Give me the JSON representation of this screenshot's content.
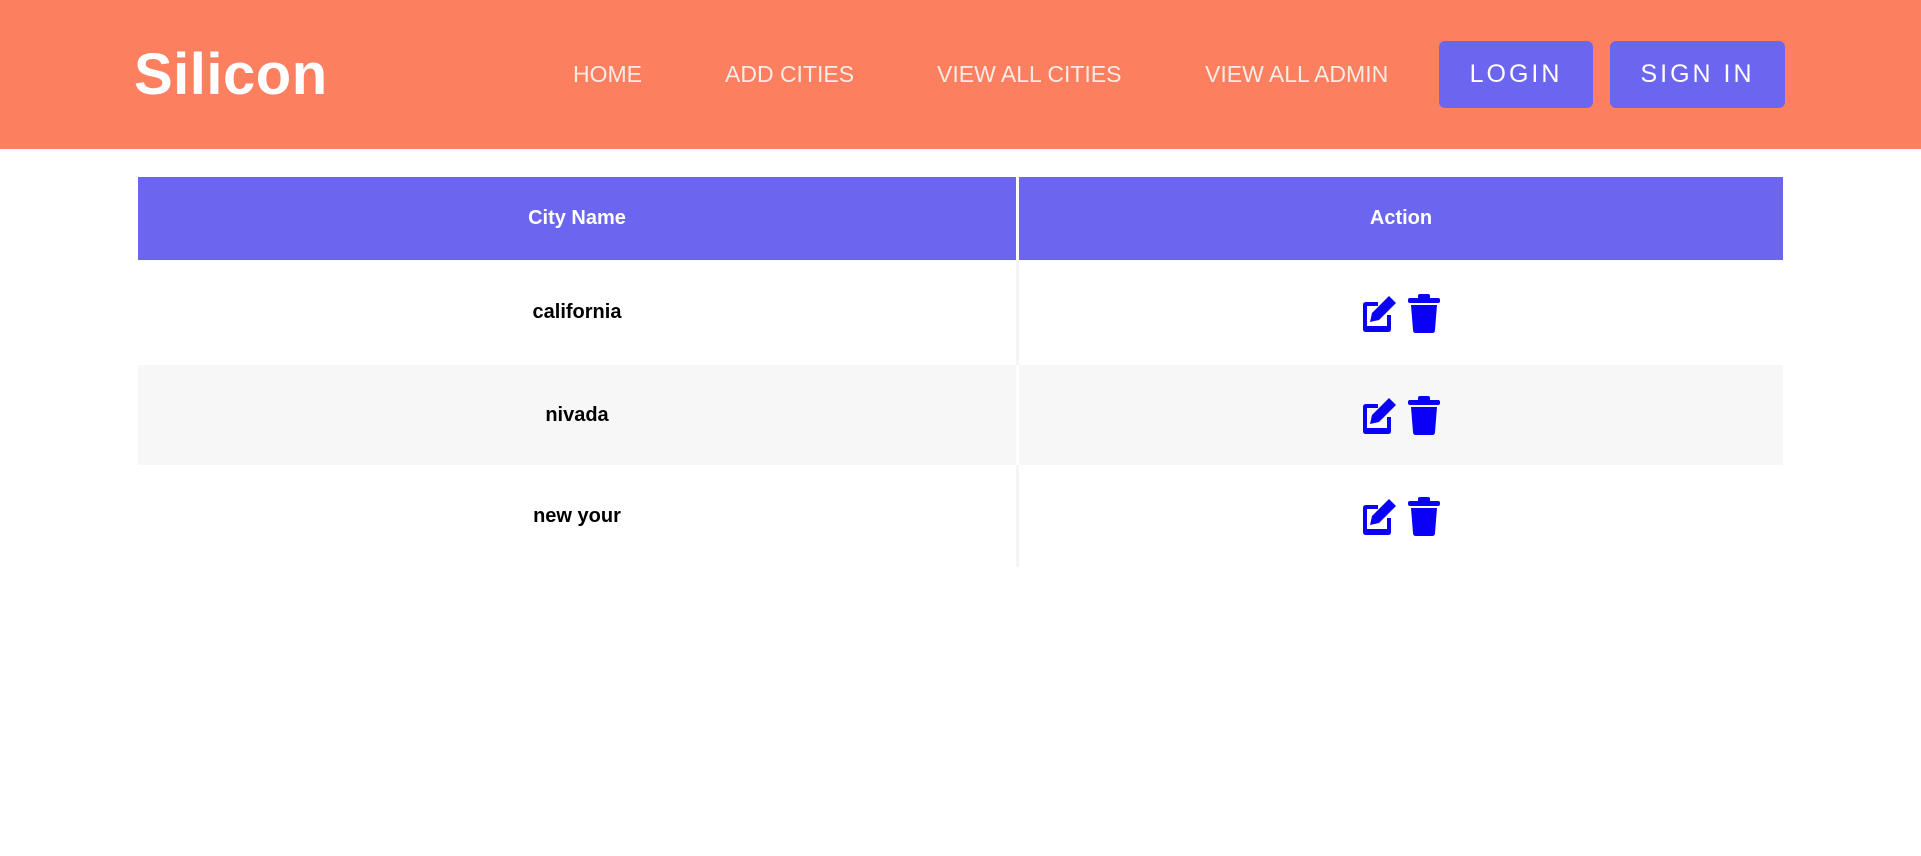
{
  "navbar": {
    "brand": "Silicon",
    "links": [
      {
        "label": "HOME"
      },
      {
        "label": "ADD CITIES"
      },
      {
        "label": "VIEW ALL CITIES"
      },
      {
        "label": "VIEW ALL ADMIN"
      }
    ],
    "login_label": "LOGIN",
    "signin_label": "SIGN IN"
  },
  "table": {
    "headers": [
      "City Name",
      "Action"
    ],
    "rows": [
      {
        "city": "california",
        "actions": [
          "edit-icon",
          "trash-icon"
        ]
      },
      {
        "city": "nivada",
        "actions": [
          "edit-icon",
          "trash-icon"
        ]
      },
      {
        "city": "new your",
        "actions": [
          "edit-icon",
          "trash-icon"
        ]
      }
    ]
  },
  "colors": {
    "navbar_bg": "#fc7f5f",
    "accent": "#6c65ef",
    "icon": "#0a00f5",
    "row_alt": "#f7f7f7"
  }
}
